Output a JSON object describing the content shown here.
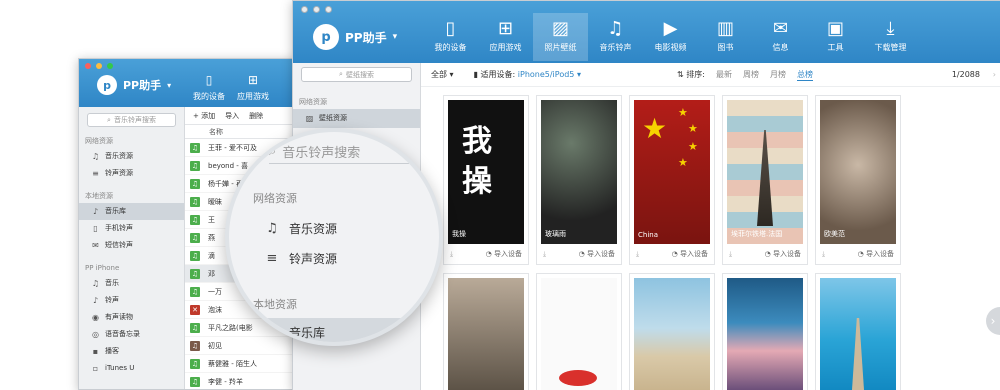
{
  "app": {
    "name": "PP助手"
  },
  "back_window": {
    "nav": [
      {
        "label": "我的设备",
        "icon": "phone-icon"
      },
      {
        "label": "应用游戏",
        "icon": "apps-icon"
      },
      {
        "label": "照",
        "icon": "image-icon"
      }
    ],
    "search_placeholder": "音乐铃声搜索",
    "sections": [
      {
        "title": "网络资源",
        "items": [
          {
            "label": "音乐资源",
            "icon": "headphones-icon"
          },
          {
            "label": "铃声资源",
            "icon": "music-list-icon"
          }
        ]
      },
      {
        "title": "本地资源",
        "items": [
          {
            "label": "音乐库",
            "icon": "music-lib-icon",
            "selected": true
          },
          {
            "label": "手机铃声",
            "icon": "phone-bell-icon"
          },
          {
            "label": "短信铃声",
            "icon": "sms-icon"
          }
        ]
      },
      {
        "title": "PP iPhone",
        "items": [
          {
            "label": "音乐",
            "icon": "note-icon"
          },
          {
            "label": "铃声",
            "icon": "bell-icon"
          },
          {
            "label": "有声读物",
            "icon": "book-icon"
          },
          {
            "label": "语音备忘录",
            "icon": "mic-icon"
          },
          {
            "label": "播客",
            "icon": "podcast-icon"
          },
          {
            "label": "iTunes U",
            "icon": "itunes-icon"
          }
        ]
      }
    ],
    "toolbar": {
      "add": "+ 添加",
      "import": "导入",
      "delete": "删除"
    },
    "column_name": "名称",
    "rows": [
      {
        "title": "王菲 - 爱不可及",
        "thumb": "green"
      },
      {
        "title": "beyond - 喜",
        "thumb": "green"
      },
      {
        "title": "杨千嬅 - 再",
        "thumb": "green"
      },
      {
        "title": "暧昧",
        "thumb": "green"
      },
      {
        "title": "王",
        "thumb": "green"
      },
      {
        "title": "燕",
        "thumb": "green"
      },
      {
        "title": "滴",
        "thumb": "green"
      },
      {
        "title": "邓",
        "thumb": "green",
        "highlight": true
      },
      {
        "title": "一万",
        "thumb": "green"
      },
      {
        "title": "泡沫",
        "thumb": "red"
      },
      {
        "title": "平凡之路(电影",
        "thumb": "green"
      },
      {
        "title": "初见",
        "thumb": "pic"
      },
      {
        "title": "蔡健雅 - 陌生人",
        "thumb": "green"
      },
      {
        "title": "李健 - 羚羊",
        "thumb": "green"
      },
      {
        "title": "孟文 - 平凡之",
        "thumb": "green"
      }
    ]
  },
  "front_window": {
    "nav": [
      {
        "label": "我的设备",
        "icon": "phone-icon"
      },
      {
        "label": "应用游戏",
        "icon": "apps-icon"
      },
      {
        "label": "照片壁纸",
        "icon": "image-icon",
        "active": true
      },
      {
        "label": "音乐铃声",
        "icon": "music-icon"
      },
      {
        "label": "电影视频",
        "icon": "video-icon"
      },
      {
        "label": "图书",
        "icon": "book-icon"
      },
      {
        "label": "信息",
        "icon": "mail-icon"
      },
      {
        "label": "工具",
        "icon": "toolbox-icon"
      },
      {
        "label": "下载管理",
        "icon": "download-icon"
      }
    ],
    "search_placeholder": "壁纸搜索",
    "sidebar": {
      "section": "网络资源",
      "items": [
        {
          "label": "壁纸资源",
          "selected": true
        },
        {
          "label": "壁纸"
        }
      ]
    },
    "filter": {
      "all": "全部",
      "device_label": "适用设备:",
      "device_value": "iPhone5/iPod5",
      "sort_label": "排序:",
      "sorts": [
        "最新",
        "周榜",
        "月榜",
        "总榜"
      ],
      "active_sort": "总榜",
      "page": "1/2088"
    },
    "cards": [
      {
        "caption": "我操",
        "action": "导入设备"
      },
      {
        "caption": "玻璃雨",
        "action": "导入设备"
      },
      {
        "caption": "China",
        "action": "导入设备"
      },
      {
        "caption": "埃菲尔铁塔.法国",
        "action": "导入设备"
      },
      {
        "caption": "欧美范",
        "action": "导入设备"
      }
    ],
    "wallpaper_text": {
      "calligraphy": "我\n操"
    }
  },
  "lens": {
    "search_placeholder": "音乐铃声搜索",
    "section1": "网络资源",
    "item1": "音乐资源",
    "item2": "铃声资源",
    "section2": "本地资源",
    "item3": "音乐库"
  },
  "colors": {
    "brand": "#2f86c6",
    "active_sort": "#2f86c6"
  }
}
